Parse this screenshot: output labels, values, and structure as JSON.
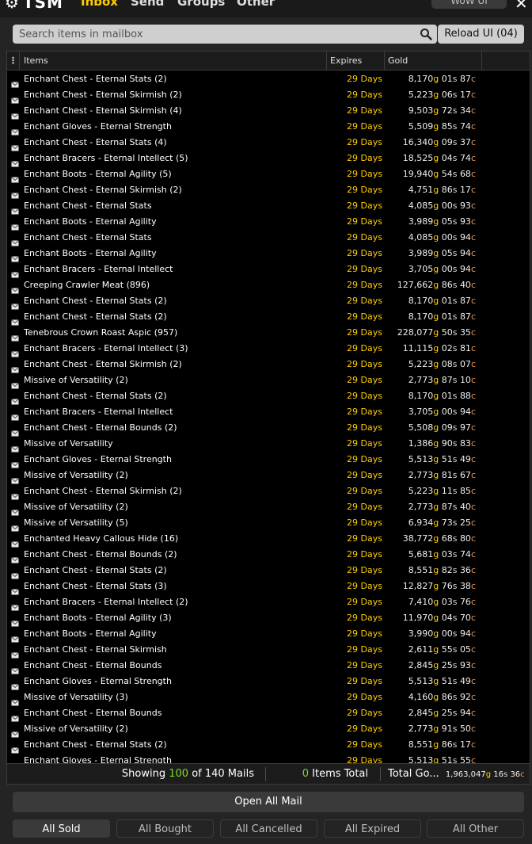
{
  "app": {
    "logo_text": "TSM",
    "tabs": [
      {
        "label": "Inbox",
        "active": true
      },
      {
        "label": "Send",
        "active": false
      },
      {
        "label": "Groups",
        "active": false
      },
      {
        "label": "Other",
        "active": false
      }
    ],
    "version": "WoW UI"
  },
  "search": {
    "placeholder": "Search items in mailbox",
    "value": ""
  },
  "reload_button": "Reload UI (04)",
  "table": {
    "columns": {
      "menu": "⋮",
      "items": "Items",
      "expires": "Expires",
      "gold": "Gold"
    },
    "rows": [
      {
        "item": "Enchant Chest - Eternal Stats (2)",
        "expires": "29 Days",
        "gold": "8,170",
        "silver": "01",
        "copper": "87"
      },
      {
        "item": "Enchant Chest - Eternal Skirmish (2)",
        "expires": "29 Days",
        "gold": "5,223",
        "silver": "06",
        "copper": "17"
      },
      {
        "item": "Enchant Chest - Eternal Skirmish (4)",
        "expires": "29 Days",
        "gold": "9,503",
        "silver": "72",
        "copper": "34"
      },
      {
        "item": "Enchant Gloves - Eternal Strength",
        "expires": "29 Days",
        "gold": "5,509",
        "silver": "85",
        "copper": "74"
      },
      {
        "item": "Enchant Chest - Eternal Stats (4)",
        "expires": "29 Days",
        "gold": "16,340",
        "silver": "09",
        "copper": "37"
      },
      {
        "item": "Enchant Bracers - Eternal Intellect (5)",
        "expires": "29 Days",
        "gold": "18,525",
        "silver": "04",
        "copper": "74"
      },
      {
        "item": "Enchant Boots - Eternal Agility (5)",
        "expires": "29 Days",
        "gold": "19,940",
        "silver": "54",
        "copper": "68"
      },
      {
        "item": "Enchant Chest - Eternal Skirmish (2)",
        "expires": "29 Days",
        "gold": "4,751",
        "silver": "86",
        "copper": "17"
      },
      {
        "item": "Enchant Chest - Eternal Stats",
        "expires": "29 Days",
        "gold": "4,085",
        "silver": "00",
        "copper": "93"
      },
      {
        "item": "Enchant Boots - Eternal Agility",
        "expires": "29 Days",
        "gold": "3,989",
        "silver": "05",
        "copper": "93"
      },
      {
        "item": "Enchant Chest - Eternal Stats",
        "expires": "29 Days",
        "gold": "4,085",
        "silver": "00",
        "copper": "94"
      },
      {
        "item": "Enchant Boots - Eternal Agility",
        "expires": "29 Days",
        "gold": "3,989",
        "silver": "05",
        "copper": "94"
      },
      {
        "item": "Enchant Bracers - Eternal Intellect",
        "expires": "29 Days",
        "gold": "3,705",
        "silver": "00",
        "copper": "94"
      },
      {
        "item": "Creeping Crawler Meat (896)",
        "expires": "29 Days",
        "gold": "127,662",
        "silver": "86",
        "copper": "40"
      },
      {
        "item": "Enchant Chest - Eternal Stats (2)",
        "expires": "29 Days",
        "gold": "8,170",
        "silver": "01",
        "copper": "87"
      },
      {
        "item": "Enchant Chest - Eternal Stats (2)",
        "expires": "29 Days",
        "gold": "8,170",
        "silver": "01",
        "copper": "87"
      },
      {
        "item": "Tenebrous Crown Roast Aspic (957)",
        "expires": "29 Days",
        "gold": "228,077",
        "silver": "50",
        "copper": "35"
      },
      {
        "item": "Enchant Bracers - Eternal Intellect (3)",
        "expires": "29 Days",
        "gold": "11,115",
        "silver": "02",
        "copper": "81"
      },
      {
        "item": "Enchant Chest - Eternal Skirmish (2)",
        "expires": "29 Days",
        "gold": "5,223",
        "silver": "08",
        "copper": "07"
      },
      {
        "item": "Missive of Versatility (2)",
        "expires": "29 Days",
        "gold": "2,773",
        "silver": "87",
        "copper": "10"
      },
      {
        "item": "Enchant Chest - Eternal Stats (2)",
        "expires": "29 Days",
        "gold": "8,170",
        "silver": "01",
        "copper": "88"
      },
      {
        "item": "Enchant Bracers - Eternal Intellect",
        "expires": "29 Days",
        "gold": "3,705",
        "silver": "00",
        "copper": "94"
      },
      {
        "item": "Enchant Chest - Eternal Bounds (2)",
        "expires": "29 Days",
        "gold": "5,508",
        "silver": "09",
        "copper": "97"
      },
      {
        "item": "Missive of Versatility",
        "expires": "29 Days",
        "gold": "1,386",
        "silver": "90",
        "copper": "83"
      },
      {
        "item": "Enchant Gloves - Eternal Strength",
        "expires": "29 Days",
        "gold": "5,513",
        "silver": "51",
        "copper": "49"
      },
      {
        "item": "Missive of Versatility (2)",
        "expires": "29 Days",
        "gold": "2,773",
        "silver": "81",
        "copper": "67"
      },
      {
        "item": "Enchant Chest - Eternal Skirmish (2)",
        "expires": "29 Days",
        "gold": "5,223",
        "silver": "11",
        "copper": "85"
      },
      {
        "item": "Missive of Versatility (2)",
        "expires": "29 Days",
        "gold": "2,773",
        "silver": "87",
        "copper": "40"
      },
      {
        "item": "Missive of Versatility (5)",
        "expires": "29 Days",
        "gold": "6,934",
        "silver": "73",
        "copper": "25"
      },
      {
        "item": "Enchanted Heavy Callous Hide (16)",
        "expires": "29 Days",
        "gold": "38,772",
        "silver": "68",
        "copper": "80"
      },
      {
        "item": "Enchant Chest - Eternal Bounds (2)",
        "expires": "29 Days",
        "gold": "5,681",
        "silver": "03",
        "copper": "74"
      },
      {
        "item": "Enchant Chest - Eternal Stats (2)",
        "expires": "29 Days",
        "gold": "8,551",
        "silver": "82",
        "copper": "36"
      },
      {
        "item": "Enchant Chest - Eternal Stats (3)",
        "expires": "29 Days",
        "gold": "12,827",
        "silver": "76",
        "copper": "38"
      },
      {
        "item": "Enchant Bracers - Eternal Intellect (2)",
        "expires": "29 Days",
        "gold": "7,410",
        "silver": "03",
        "copper": "76"
      },
      {
        "item": "Enchant Boots - Eternal Agility (3)",
        "expires": "29 Days",
        "gold": "11,970",
        "silver": "04",
        "copper": "70"
      },
      {
        "item": "Enchant Boots - Eternal Agility",
        "expires": "29 Days",
        "gold": "3,990",
        "silver": "00",
        "copper": "94"
      },
      {
        "item": "Enchant Chest - Eternal Skirmish",
        "expires": "29 Days",
        "gold": "2,611",
        "silver": "55",
        "copper": "05"
      },
      {
        "item": "Enchant Chest - Eternal Bounds",
        "expires": "29 Days",
        "gold": "2,845",
        "silver": "25",
        "copper": "93"
      },
      {
        "item": "Enchant Gloves - Eternal Strength",
        "expires": "29 Days",
        "gold": "5,513",
        "silver": "51",
        "copper": "49"
      },
      {
        "item": "Missive of Versatility (3)",
        "expires": "29 Days",
        "gold": "4,160",
        "silver": "86",
        "copper": "92"
      },
      {
        "item": "Enchant Chest - Eternal Bounds",
        "expires": "29 Days",
        "gold": "2,845",
        "silver": "25",
        "copper": "94"
      },
      {
        "item": "Missive of Versatility (2)",
        "expires": "29 Days",
        "gold": "2,773",
        "silver": "91",
        "copper": "50"
      },
      {
        "item": "Enchant Chest - Eternal Stats (2)",
        "expires": "29 Days",
        "gold": "8,551",
        "silver": "86",
        "copper": "17"
      },
      {
        "item": "Enchant Gloves - Eternal Strength",
        "expires": "29 Days",
        "gold": "5,513",
        "silver": "51",
        "copper": "55"
      }
    ],
    "currency": {
      "g": "g",
      "s": "s",
      "c": "c"
    }
  },
  "footer": {
    "showing_prefix": "Showing",
    "showing_count": "100",
    "showing_suffix": "of 140 Mails",
    "items_count": "0",
    "items_label": "Items Total",
    "total_gold_label": "Total Go...",
    "total_gold": "1,963,047",
    "total_silver": "16",
    "total_copper": "36"
  },
  "buttons": {
    "open_all": "Open All Mail",
    "filters": [
      {
        "label": "All Sold",
        "active": true
      },
      {
        "label": "All Bought",
        "active": false
      },
      {
        "label": "All Cancelled",
        "active": false
      },
      {
        "label": "All Expired",
        "active": false
      },
      {
        "label": "All Other",
        "active": false
      }
    ]
  },
  "colors": {
    "gold": "#ffcc00",
    "silver": "#d8d8d8",
    "copper": "#e89550",
    "highlight_green": "#7ddc2a"
  }
}
